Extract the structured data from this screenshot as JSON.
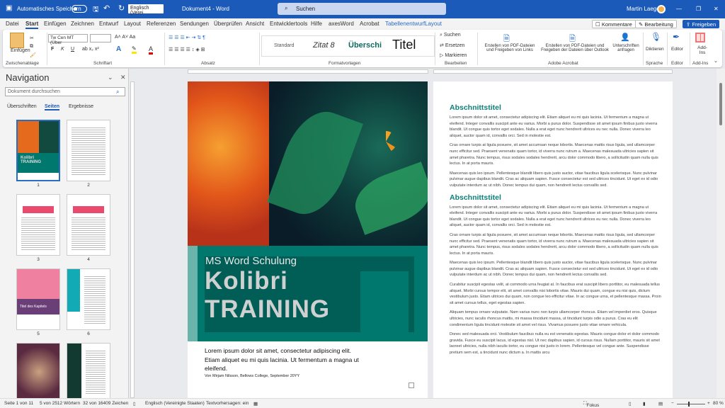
{
  "titlebar": {
    "autosave": "Automatisches Speichern",
    "language": "Englisch (Verei",
    "doc_title": "Dokument4 - Word",
    "search": "Suchen",
    "user": "Martin Laeger",
    "minimize": "—",
    "restore": "❐",
    "close": "✕"
  },
  "tabs": [
    "Datei",
    "Start",
    "Einfügen",
    "Zeichnen",
    "Entwurf",
    "Layout",
    "Referenzen",
    "Sendungen",
    "Überprüfen",
    "Ansicht",
    "Entwicklertools",
    "Hilfe",
    "axesWord",
    "Acrobat",
    "Tabellenentwurf",
    "Layout"
  ],
  "tab_buttons": {
    "comments": "Kommentare",
    "editing": "Bearbeitung",
    "share": "Freigeben"
  },
  "ribbon": {
    "clipboard": {
      "paste": "Einfügen",
      "group": "Zwischenablage"
    },
    "font": {
      "font_name": "Tw Cen MT (Über",
      "font_size": "",
      "group": "Schriftart",
      "bold": "F",
      "italic": "K",
      "underline": "U"
    },
    "paragraph": {
      "group": "Absatz"
    },
    "styles": {
      "items": [
        "Standard",
        "Zitat 8",
        "Überschi",
        "Titel"
      ],
      "group": "Formatvorlagen"
    },
    "editing": {
      "find": "Suchen",
      "replace": "Ersetzen",
      "select": "Markieren",
      "group": "Bearbeiten"
    },
    "acrobat": {
      "b1": "Erstellen von PDF-Dateien und Freigeben von Links",
      "b2": "Erstellen von PDF-Dateien und Freigeben der Dateien über Outlook",
      "b3": "Unterschriften anfragen",
      "group": "Adobe Acrobat"
    },
    "voice": {
      "dictate": "Diktieren",
      "group": "Sprache"
    },
    "editor": {
      "label": "Editor",
      "group": "Editor"
    },
    "addins": {
      "label": "Add-Ins",
      "group": "Add-Ins"
    }
  },
  "navigation": {
    "title": "Navigation",
    "search_placeholder": "Dokument durchsuchen",
    "tabs": [
      "Überschriften",
      "Seiten",
      "Ergebnisse"
    ],
    "active_tab": "Seiten",
    "pages": [
      "1",
      "2",
      "3",
      "4",
      "5",
      "6"
    ],
    "thumb5_title": "Titel des Kapitels"
  },
  "page1": {
    "subtitle": "MS Word Schulung",
    "title1": "Kolibri",
    "title2": "TRAINING",
    "intro": "Lorem ipsum dolor sit amet, consectetur adipiscing elit. Etiam aliquet eu mi quis lacinia. Ut fermentum a magna ut eleifend.",
    "byline": "Von Mirjam Nilsson, Bellows College, September 20YY"
  },
  "page2": {
    "sections": [
      {
        "heading": "Abschnittstitel",
        "paragraphs": [
          "Lorem ipsum dolor sit amet, consectetur adipiscing elit. Etiam aliquet eu mi quis lacinia. Ut fermentum a magna ut eleifend. Integer convallis suscipit ante eu varius. Morbi a purus dolor. Suspendisse sit amet ipsum finibus justo viverra blandit. Ut congue quis tortor eget sodales. Nulla a erat eget nunc hendrerit ultrices eu nec nulla. Donec viverra leo aliquet, auctor quam id, convallis orci. Sed in molestie est.",
          "Cras ornare turpis at ligula posuere, sit amet accumsan neque lobortis. Maecenas mattis risus ligula, sed ullamcorper nunc efficitur sed. Praesent venenatis quam tortor, id viverra nunc rutrum a. Maecenas malesuada ultricies sapien sit amet pharetra. Nunc tempus, risus sodales sodales hendrerit, arcu dolor commodo libero, a sollicitudin quam nulla quis lectus. In at porta mauris.",
          "Maecenas quis leo ipsum. Pellentesque blandit libero quis justo auctor, vitae faucibus ligula scelerisque. Nunc pulvinar pulvinar augue dapibus blandit. Cras ac aliquam sapien. Fusce consectetur est sed ultrices tincidunt. Ut eget ex id odio vulputate interdum ac ut nibh. Donec tempus dui quam, non hendrerit lectus convallis sed."
        ]
      },
      {
        "heading": "Abschnittstitel",
        "paragraphs": [
          "Lorem ipsum dolor sit amet, consectetur adipiscing elit. Etiam aliquet eu mi quis lacinia. Ut fermentum a magna ut eleifend. Integer convallis suscipit ante eu varius. Morbi a purus dolor. Suspendisse sit amet ipsum finibus justo viverra blandit. Ut congue quis tortor eget sodales. Nulla a erat eget nunc hendrerit ultrices eu nec nulla. Donec viverra leo aliquet, auctor quam id, convallis orci. Sed in molestie est.",
          "Cras ornare turpis at ligula posuere, sit amet accumsan neque lobortis. Maecenas mattis risus ligula, sed ullamcorper nunc efficitur sed. Praesent venenatis quam tortor, id viverra nunc rutrum a. Maecenas malesuada ultricies sapien sit amet pharetra. Nunc tempus, risus sodales sodales hendrerit, arcu dolor commodo libero, a sollicitudin quam nulla quis lectus. In at porta mauris.",
          "Maecenas quis leo ipsum. Pellentesque blandit libero quis justo auctor, vitae faucibus ligula scelerisque. Nunc pulvinar pulvinar augue dapibus blandit. Cras ac aliquam sapien. Fusce consectetur est sed ultrices tincidunt. Ut eget ex id odio vulputate interdum ac ut nibh. Donec tempus dui quam, non hendrerit lectus convallis sed.",
          "Curabitur suscipit egestas velit, at commodo urna feugiat at. In faucibus erat suscipit libero porttitor, eu malesuada tellus aliquet. Morbi cursus tempor elit, sit amet convallis nisi lobortis vitae. Mauris dui quam, congue eu nisi quis, dictum vestibulum justo. Etiam ultrices dui quam, non congue leo efficitur vitae. In ac congue urna, et pellentesque massa. Proin sit amet cursus tellus, eget egestas sapien.",
          "Aliquam tempus ornare vulputate. Nam varius nunc non turpis ullamcorper rhoncus. Etiam vel imperdiet eros. Quisque ultricies, nunc iaculis rhoncus mattis, mi massa tincidunt massa, ut tincidunt turpis odio a purus. Cras eu elit condimentum ligula tincidunt molestie sit amet vel risus. Vivamus posuere justo vitae ornare vehicula.",
          "Donec sed malesuada orci. Vestibulum faucibus nulla eu est venenatis egestas. Mauris congue dolor et dolor commodo gravida. Fusce eu suscipit lacus, id egestas nisl. Ut nec dapibus sapien, id cursus risus. Nullam porttitor, mauris sit amet laoreet ultricies, nulla nibh iaculis tortor, eu congue nisi justo in lorem. Pellentesque vel congue ante. Suspendisse pretium sem est, a tincidunt nunc dictum a. In mattis arcu"
        ]
      }
    ]
  },
  "status": {
    "page": "Seite 1 von 11",
    "words": "5 von 2512 Wörtern",
    "chars": "32 von 16409 Zeichen",
    "language": "Englisch (Vereinigte Staaten)",
    "predictions": "Textvorhersagen: ein",
    "focus": "Fokus",
    "zoom": "80 %",
    "zoom_percent": 80
  },
  "colors": {
    "accent": "#1b5ab8",
    "teal": "#00786e",
    "heading": "#0d8078"
  }
}
